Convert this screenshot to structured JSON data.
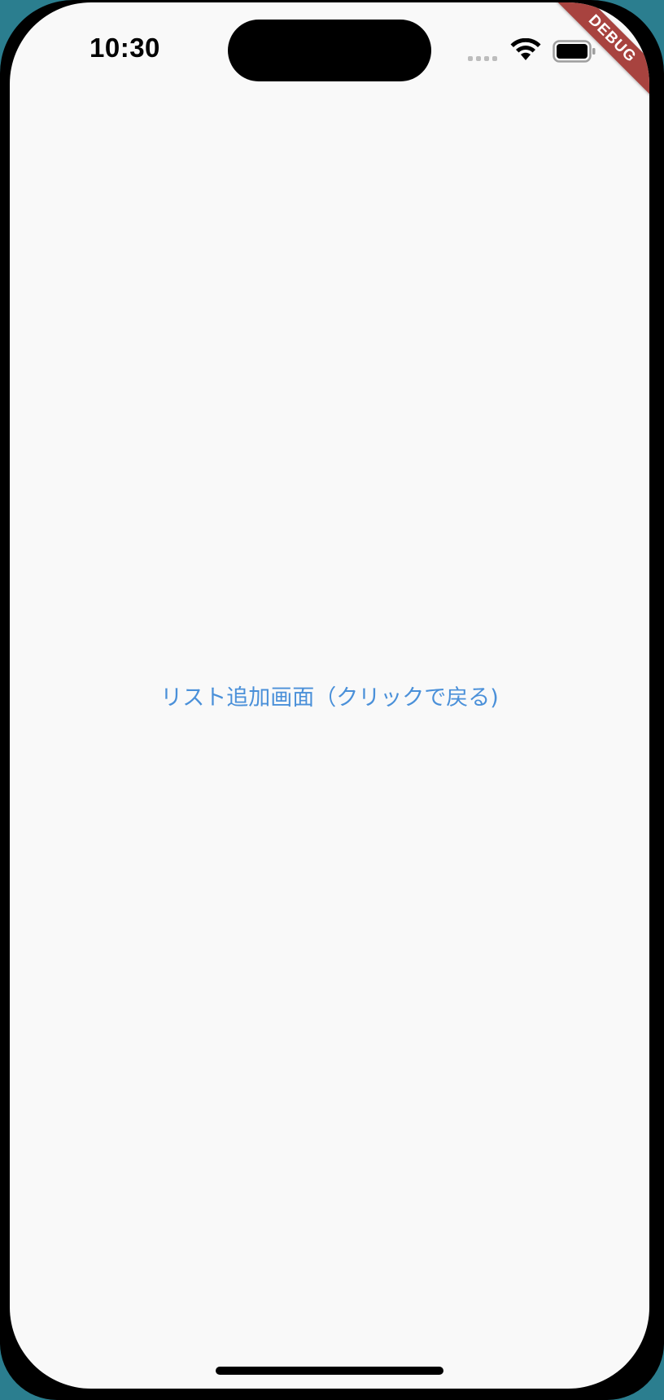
{
  "status_bar": {
    "time": "10:30",
    "icons": [
      "signal-icon",
      "wifi-icon",
      "battery-icon"
    ]
  },
  "debug_banner": {
    "label": "DEBUG",
    "color": "#a8433f"
  },
  "main": {
    "link_text": "リスト追加画面（クリックで戻る)",
    "link_color": "#4a90d9"
  }
}
